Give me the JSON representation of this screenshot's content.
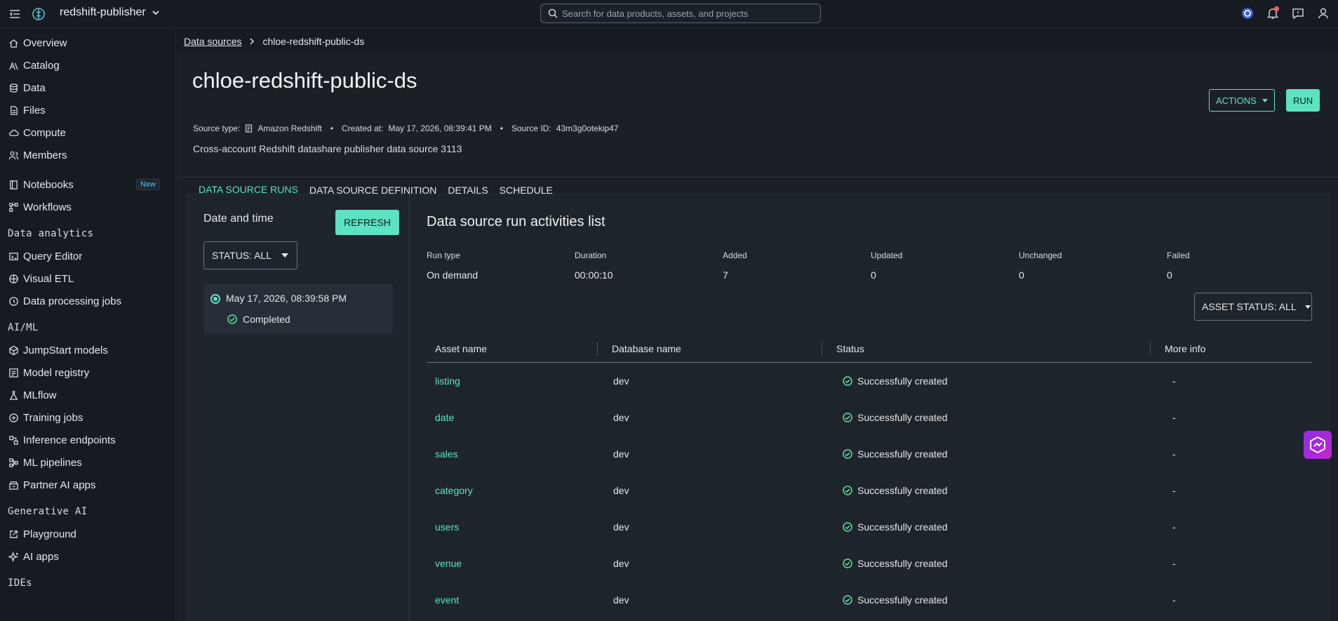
{
  "topbar": {
    "project_name": "redshift-publisher",
    "search_placeholder": "Search for data products, assets, and projects"
  },
  "sidebar": {
    "items_main": [
      {
        "label": "Overview",
        "icon": "home-icon"
      },
      {
        "label": "Catalog",
        "icon": "catalog-icon"
      },
      {
        "label": "Data",
        "icon": "database-icon"
      },
      {
        "label": "Files",
        "icon": "file-icon"
      },
      {
        "label": "Compute",
        "icon": "cloud-icon"
      },
      {
        "label": "Members",
        "icon": "members-icon"
      }
    ],
    "items_tools": [
      {
        "label": "Notebooks",
        "icon": "notebook-icon",
        "badge": "New"
      },
      {
        "label": "Workflows",
        "icon": "workflow-icon"
      }
    ],
    "section_analytics": "Data analytics",
    "items_analytics": [
      {
        "label": "Query Editor",
        "icon": "query-editor-icon"
      },
      {
        "label": "Visual ETL",
        "icon": "visual-etl-icon"
      },
      {
        "label": "Data processing jobs",
        "icon": "processing-jobs-icon"
      }
    ],
    "section_aiml": "AI/ML",
    "items_aiml": [
      {
        "label": "JumpStart models",
        "icon": "cube-icon"
      },
      {
        "label": "Model registry",
        "icon": "registry-icon"
      },
      {
        "label": "MLflow",
        "icon": "flask-icon"
      },
      {
        "label": "Training jobs",
        "icon": "training-icon"
      },
      {
        "label": "Inference endpoints",
        "icon": "endpoint-icon"
      },
      {
        "label": "ML pipelines",
        "icon": "pipeline-icon"
      },
      {
        "label": "Partner AI apps",
        "icon": "partner-apps-icon"
      }
    ],
    "section_genai": "Generative AI",
    "items_genai": [
      {
        "label": "Playground",
        "icon": "playground-icon"
      },
      {
        "label": "AI apps",
        "icon": "sparkle-icon"
      }
    ],
    "section_ides": "IDEs"
  },
  "breadcrumb": {
    "parent": "Data sources",
    "current": "chloe-redshift-public-ds"
  },
  "header": {
    "title": "chloe-redshift-public-ds",
    "source_type_label": "Source type:",
    "source_type_value": "Amazon Redshift",
    "created_label": "Created at:",
    "created_value": "May 17, 2026, 08:39:41 PM",
    "source_id_label": "Source ID:",
    "source_id_value": "43m3g0otekip47",
    "description": "Cross-account Redshift datashare publisher data source 3113",
    "actions_label": "ACTIONS",
    "run_label": "RUN"
  },
  "tabs": [
    "DATA SOURCE RUNS",
    "DATA SOURCE DEFINITION",
    "DETAILS",
    "SCHEDULE"
  ],
  "runs_pane": {
    "title": "Date and time",
    "refresh_label": "REFRESH",
    "status_filter": "STATUS: ALL",
    "run_date": "May 17, 2026, 08:39:58 PM",
    "run_status": "Completed"
  },
  "activities": {
    "title": "Data source run activities list",
    "stats": [
      {
        "label": "Run type",
        "value": "On demand"
      },
      {
        "label": "Duration",
        "value": "00:00:10"
      },
      {
        "label": "Added",
        "value": "7"
      },
      {
        "label": "Updated",
        "value": "0"
      },
      {
        "label": "Unchanged",
        "value": "0"
      },
      {
        "label": "Failed",
        "value": "0"
      }
    ],
    "asset_status_filter": "ASSET STATUS: ALL",
    "columns": [
      "Asset name",
      "Database name",
      "Status",
      "More info"
    ],
    "rows": [
      {
        "asset": "listing",
        "db": "dev",
        "status": "Successfully created",
        "info": "-"
      },
      {
        "asset": "date",
        "db": "dev",
        "status": "Successfully created",
        "info": "-"
      },
      {
        "asset": "sales",
        "db": "dev",
        "status": "Successfully created",
        "info": "-"
      },
      {
        "asset": "category",
        "db": "dev",
        "status": "Successfully created",
        "info": "-"
      },
      {
        "asset": "users",
        "db": "dev",
        "status": "Successfully created",
        "info": "-"
      },
      {
        "asset": "venue",
        "db": "dev",
        "status": "Successfully created",
        "info": "-"
      },
      {
        "asset": "event",
        "db": "dev",
        "status": "Successfully created",
        "info": "-"
      }
    ]
  },
  "colors": {
    "accent": "#5de3c2",
    "background": "#161b22",
    "panel": "#1e242c"
  }
}
